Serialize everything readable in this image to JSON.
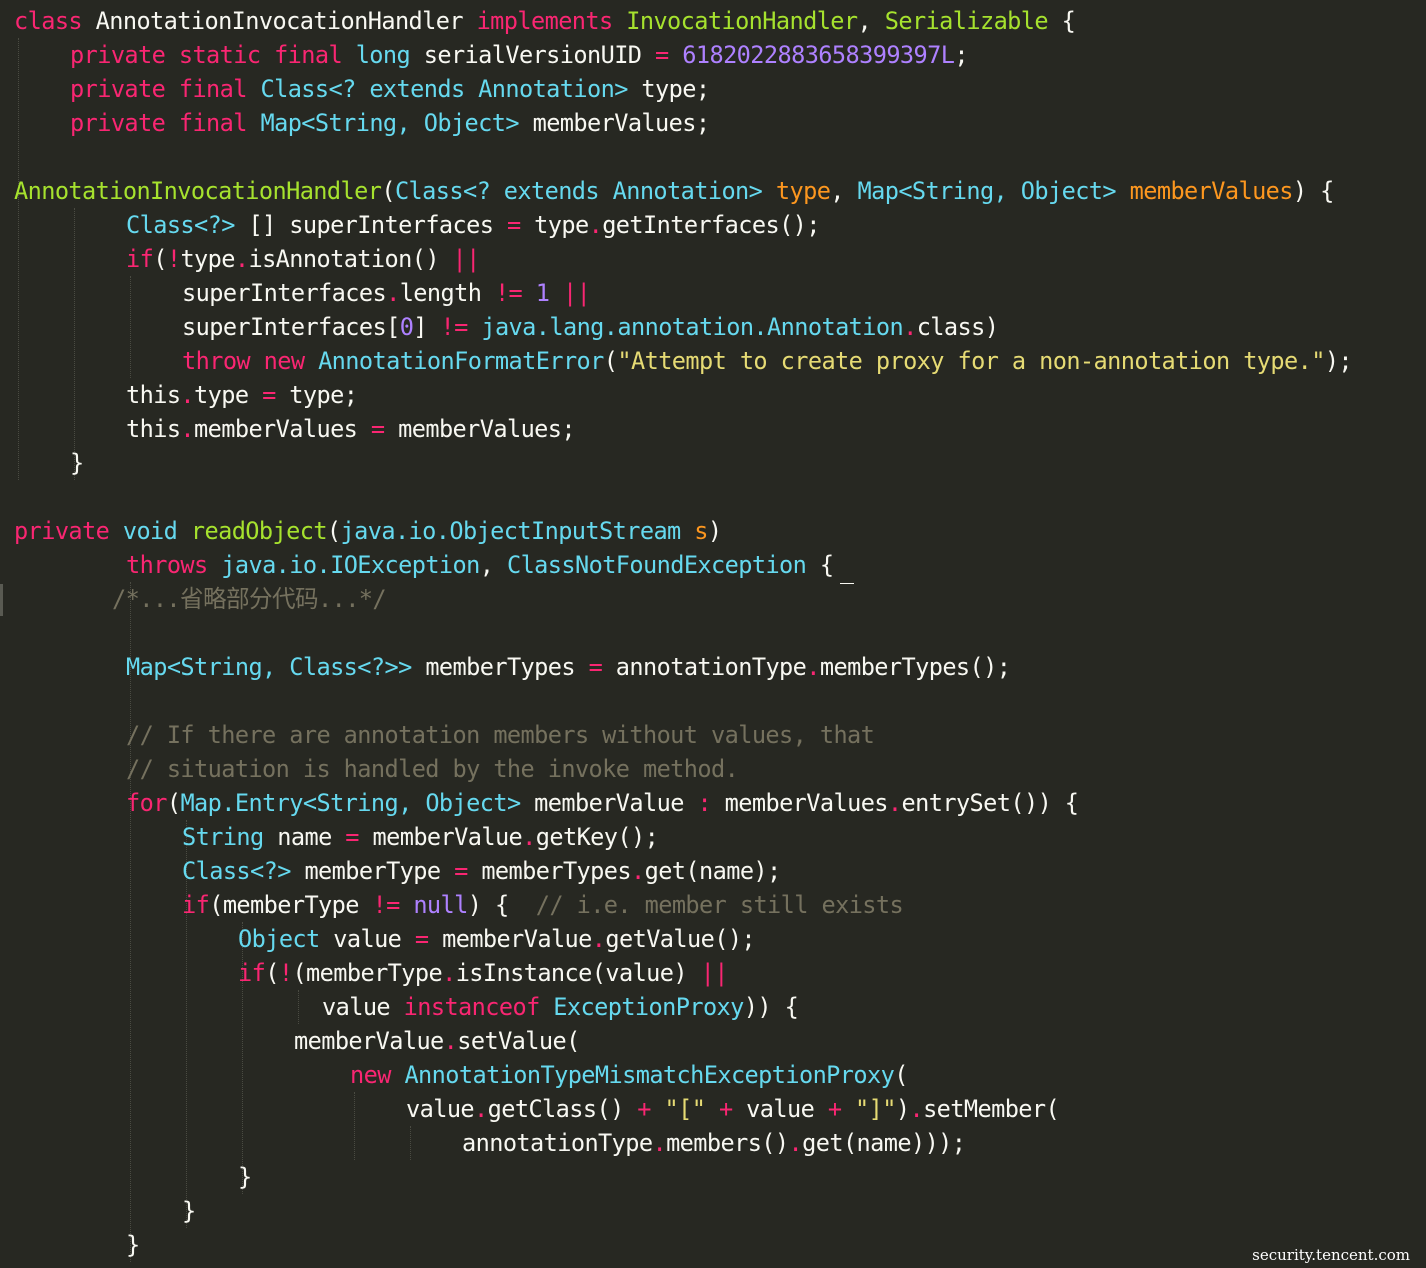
{
  "editor": {
    "theme": "monokai",
    "colors": {
      "background": "#272822",
      "text": "#f8f8f2",
      "keyword": "#f92672",
      "type": "#66d9ef",
      "name": "#a6e22e",
      "number": "#ae81ff",
      "string": "#e6db74",
      "comment": "#75715e",
      "param": "#fd971f"
    },
    "lines": [
      [
        [
          "k",
          "class"
        ],
        [
          "",
          "AnnotationInvocationHandler"
        ],
        [
          "k",
          "implements"
        ],
        [
          "g",
          "InvocationHandler"
        ],
        [
          "",
          ","
        ],
        [
          "g",
          "Serializable"
        ],
        [
          "",
          "{"
        ]
      ],
      [
        [
          "k",
          "private static final"
        ],
        [
          "t",
          "long"
        ],
        [
          "",
          "serialVersionUID"
        ],
        [
          "o",
          "="
        ],
        [
          "n",
          "6182022883658399397L"
        ],
        [
          "",
          ";"
        ]
      ],
      [
        [
          "k",
          "private final"
        ],
        [
          "t",
          "Class<? extends Annotation>"
        ],
        [
          "",
          "type;"
        ]
      ],
      [
        [
          "k",
          "private final"
        ],
        [
          "t",
          "Map<String, Object>"
        ],
        [
          "",
          "memberValues;"
        ]
      ],
      [],
      [
        [
          "g",
          "AnnotationInvocationHandler"
        ],
        [
          "",
          "("
        ],
        [
          "t",
          "Class<? extends Annotation>"
        ],
        [
          "p",
          "type"
        ],
        [
          "",
          ","
        ],
        [
          "t",
          "Map<String, Object>"
        ],
        [
          "p",
          "memberValues"
        ],
        [
          "",
          ") {"
        ]
      ],
      [
        [
          "t",
          "Class<?>"
        ],
        [
          "",
          "[] superInterfaces"
        ],
        [
          "o",
          "="
        ],
        [
          "",
          "type"
        ],
        [
          "o",
          "."
        ],
        [
          "",
          "getInterfaces();"
        ]
      ],
      [
        [
          "k",
          "if"
        ],
        [
          "",
          "("
        ],
        [
          "o",
          "!"
        ],
        [
          "",
          "type"
        ],
        [
          "o",
          "."
        ],
        [
          "",
          "isAnnotation()"
        ],
        [
          "o",
          "||"
        ]
      ],
      [
        [
          "",
          "superInterfaces"
        ],
        [
          "o",
          "."
        ],
        [
          "",
          "length"
        ],
        [
          "o",
          "!="
        ],
        [
          "n",
          "1"
        ],
        [
          "o",
          "||"
        ]
      ],
      [
        [
          "",
          "superInterfaces["
        ],
        [
          "n",
          "0"
        ],
        [
          "",
          "]"
        ],
        [
          "o",
          "!="
        ],
        [
          "t",
          "java.lang.annotation.Annotation"
        ],
        [
          "o",
          "."
        ],
        [
          "",
          "class)"
        ]
      ],
      [
        [
          "k",
          "throw new"
        ],
        [
          "t",
          "AnnotationFormatError"
        ],
        [
          "",
          "("
        ],
        [
          "s",
          "\"Attempt to create proxy for a non-annotation type.\""
        ],
        [
          "",
          ");"
        ]
      ],
      [
        [
          "",
          "this"
        ],
        [
          "o",
          "."
        ],
        [
          "",
          "type"
        ],
        [
          "o",
          "="
        ],
        [
          "",
          "type;"
        ]
      ],
      [
        [
          "",
          "this"
        ],
        [
          "o",
          "."
        ],
        [
          "",
          "memberValues"
        ],
        [
          "o",
          "="
        ],
        [
          "",
          "memberValues;"
        ]
      ],
      [
        [
          "",
          "}"
        ]
      ],
      [],
      [
        [
          "k",
          "private"
        ],
        [
          "t",
          "void"
        ],
        [
          "g",
          "readObject"
        ],
        [
          "",
          "("
        ],
        [
          "t",
          "java.io.ObjectInputStream"
        ],
        [
          "p",
          "s"
        ],
        [
          "",
          ")"
        ]
      ],
      [
        [
          "k",
          "throws"
        ],
        [
          "t",
          "java.io.IOException"
        ],
        [
          "",
          ","
        ],
        [
          "t",
          "ClassNotFoundException"
        ],
        [
          "",
          "{"
        ]
      ],
      [
        [
          "c",
          "/*...省略部分代码...*/"
        ]
      ],
      [],
      [
        [
          "t",
          "Map<String, Class<?>>"
        ],
        [
          "",
          "memberTypes"
        ],
        [
          "o",
          "="
        ],
        [
          "",
          "annotationType"
        ],
        [
          "o",
          "."
        ],
        [
          "",
          "memberTypes();"
        ]
      ],
      [],
      [
        [
          "c",
          "// If there are annotation members without values, that"
        ]
      ],
      [
        [
          "c",
          "// situation is handled by the invoke method."
        ]
      ],
      [
        [
          "k",
          "for"
        ],
        [
          "",
          "("
        ],
        [
          "t",
          "Map.Entry<String, Object>"
        ],
        [
          "",
          "memberValue"
        ],
        [
          "o",
          ":"
        ],
        [
          "",
          "memberValues"
        ],
        [
          "o",
          "."
        ],
        [
          "",
          "entrySet()) {"
        ]
      ],
      [
        [
          "t",
          "String"
        ],
        [
          "",
          "name"
        ],
        [
          "o",
          "="
        ],
        [
          "",
          "memberValue"
        ],
        [
          "o",
          "."
        ],
        [
          "",
          "getKey();"
        ]
      ],
      [
        [
          "t",
          "Class<?>"
        ],
        [
          "",
          "memberType"
        ],
        [
          "o",
          "="
        ],
        [
          "",
          "memberTypes"
        ],
        [
          "o",
          "."
        ],
        [
          "",
          "get(name);"
        ]
      ],
      [
        [
          "k",
          "if"
        ],
        [
          "",
          "(memberType"
        ],
        [
          "o",
          "!="
        ],
        [
          "n",
          "null"
        ],
        [
          "",
          ") {"
        ],
        [
          "c",
          "// i.e. member still exists"
        ]
      ],
      [
        [
          "t",
          "Object"
        ],
        [
          "",
          "value"
        ],
        [
          "o",
          "="
        ],
        [
          "",
          "memberValue"
        ],
        [
          "o",
          "."
        ],
        [
          "",
          "getValue();"
        ]
      ],
      [
        [
          "k",
          "if"
        ],
        [
          "",
          "("
        ],
        [
          "o",
          "!"
        ],
        [
          "",
          "(memberType"
        ],
        [
          "o",
          "."
        ],
        [
          "",
          "isInstance(value)"
        ],
        [
          "o",
          "||"
        ]
      ],
      [
        [
          "",
          "value"
        ],
        [
          "k",
          "instanceof"
        ],
        [
          "t",
          "ExceptionProxy"
        ],
        [
          "",
          ")) {"
        ]
      ],
      [
        [
          "",
          "memberValue"
        ],
        [
          "o",
          "."
        ],
        [
          "",
          "setValue("
        ]
      ],
      [
        [
          "k",
          "new"
        ],
        [
          "t",
          "AnnotationTypeMismatchExceptionProxy"
        ],
        [
          "",
          "("
        ]
      ],
      [
        [
          "",
          "value"
        ],
        [
          "o",
          "."
        ],
        [
          "",
          "getClass()"
        ],
        [
          "o",
          "+"
        ],
        [
          "s",
          "\"[\""
        ],
        [
          "o",
          "+"
        ],
        [
          "",
          "value"
        ],
        [
          "o",
          "+"
        ],
        [
          "s",
          "\"]\""
        ],
        [
          "",
          ")"
        ],
        [
          "o",
          "."
        ],
        [
          "",
          "setMember("
        ]
      ],
      [
        [
          "",
          "annotationType"
        ],
        [
          "o",
          "."
        ],
        [
          "",
          "members()"
        ],
        [
          "o",
          "."
        ],
        [
          "",
          "get(name)));"
        ]
      ],
      [
        [
          "",
          "}"
        ]
      ],
      [
        [
          "",
          "}"
        ]
      ],
      [
        [
          "",
          "}"
        ]
      ]
    ]
  },
  "watermark": "security.tencent.com"
}
